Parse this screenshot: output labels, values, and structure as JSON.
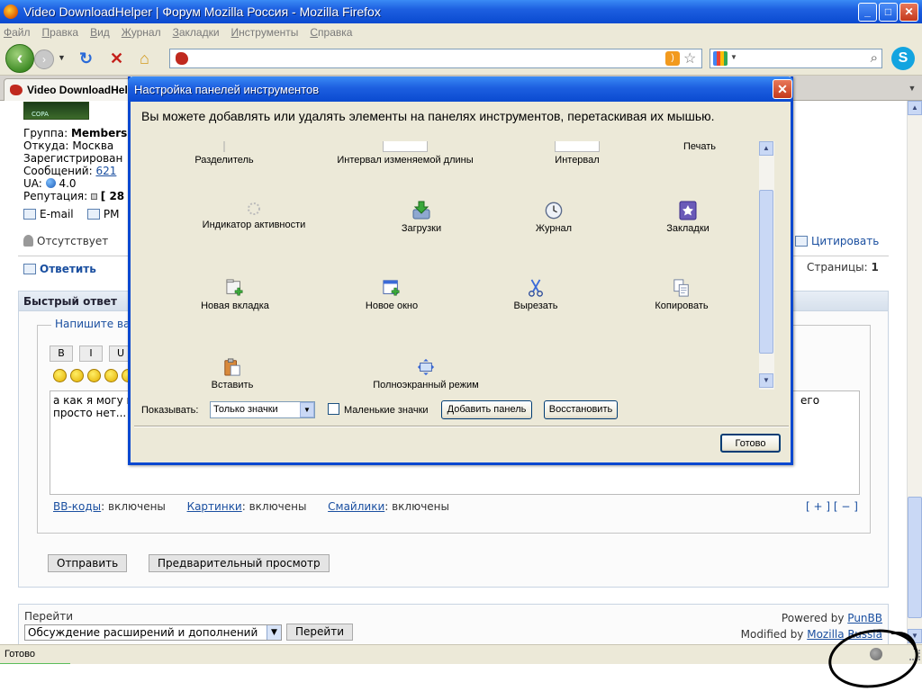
{
  "window": {
    "title": "Video DownloadHelper | Форум Mozilla Россия - Mozilla Firefox",
    "min": "_",
    "max": "□",
    "close": "✕"
  },
  "menu": [
    "Файл",
    "Правка",
    "Вид",
    "Журнал",
    "Закладки",
    "Инструменты",
    "Справка"
  ],
  "tab": {
    "label": "Video DownloadHelp"
  },
  "forum": {
    "avatar_text": "COPA",
    "user_rows": [
      {
        "label": "Группа:",
        "value": "Members"
      },
      {
        "label": "Откуда:",
        "value": "Москва"
      },
      {
        "label": "Зарегистрирован",
        "value": ""
      },
      {
        "label": "Сообщений:",
        "value": "621"
      },
      {
        "label": "UA:",
        "value": "4.0"
      },
      {
        "label": "Репутация:",
        "value": "[ 28"
      }
    ],
    "email": "E-mail",
    "pm": "PM",
    "status": "Отсутствует",
    "quote": "Цитировать",
    "reply": "Ответить",
    "pages_label": "Страницы:",
    "pages_value": "1",
    "quick_reply_title": "Быстрый ответ",
    "legend": "Напишите ва",
    "fmt_buttons": [
      "B",
      "I",
      "U"
    ],
    "textarea_line1": "а как я могу п",
    "textarea_line2": "просто нет...",
    "textarea_right": "его",
    "bb_label": "BB-коды",
    "bb_state": ": включены",
    "img_label": "Картинки",
    "img_state": ": включены",
    "smile_label": "Смайлики",
    "smile_state": ": включены",
    "expand": "[ + ] [ − ]",
    "send": "Отправить",
    "preview": "Предварительный просмотр",
    "jump_label": "Перейти",
    "jump_value": "Обсуждение расширений и дополнений",
    "jump_button": "Перейти",
    "powered_prefix": "Powered by ",
    "powered_link": "PunBB",
    "modified_prefix": "Modified by ",
    "modified_link": "Mozilla Russia"
  },
  "status_bar": {
    "text": "Готово"
  },
  "dialog": {
    "title": "Настройка панелей инструментов",
    "description": "Вы можете добавлять или удалять элементы на панелях инструментов, перетаскивая их мышью.",
    "items": [
      {
        "label": "Разделитель",
        "icon": "separator-icon"
      },
      {
        "label": "Интервал изменяемой длины",
        "icon": "flexible-space-icon"
      },
      {
        "label": "Интервал",
        "icon": "space-icon"
      },
      {
        "label": "Печать",
        "icon": "print-icon"
      },
      {
        "label": "Индикатор активности",
        "icon": "throbber-icon"
      },
      {
        "label": "Загрузки",
        "icon": "downloads-icon"
      },
      {
        "label": "Журнал",
        "icon": "history-icon"
      },
      {
        "label": "Закладки",
        "icon": "bookmarks-icon"
      },
      {
        "label": "Новая вкладка",
        "icon": "new-tab-icon"
      },
      {
        "label": "Новое окно",
        "icon": "new-window-icon"
      },
      {
        "label": "Вырезать",
        "icon": "cut-icon"
      },
      {
        "label": "Копировать",
        "icon": "copy-icon"
      },
      {
        "label": "Вставить",
        "icon": "paste-icon"
      },
      {
        "label": "Полноэкранный режим",
        "icon": "fullscreen-icon"
      }
    ],
    "show_label": "Показывать:",
    "show_value": "Только значки",
    "small_icons_label": "Маленькие значки",
    "small_icons_checked": false,
    "add_toolbar": "Добавить панель",
    "restore": "Восстановить",
    "done": "Готово"
  }
}
